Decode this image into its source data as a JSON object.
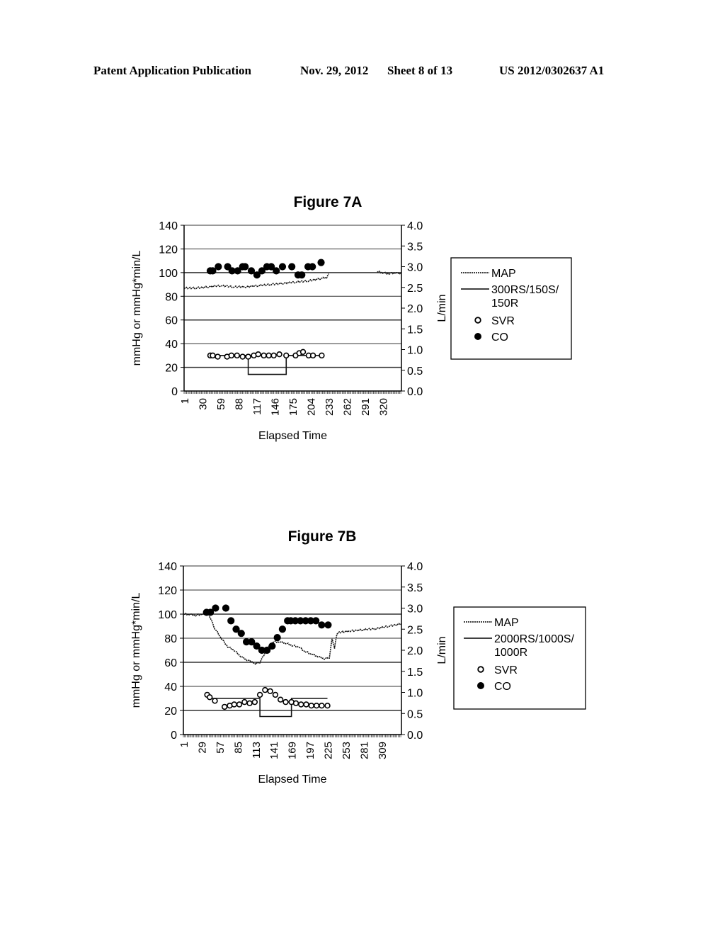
{
  "header": {
    "left": "Patent Application Publication",
    "date": "Nov. 29, 2012",
    "sheet": "Sheet 8 of 13",
    "number": "US 2012/0302637 A1"
  },
  "chart_data": [
    {
      "type": "line",
      "title": "Figure 7A",
      "xlabel": "Elapsed Time",
      "ylabel": "mmHg or mmHg*min/L",
      "y2label": "L/min",
      "xlim": [
        1,
        350
      ],
      "ylim": [
        0,
        140
      ],
      "y2lim": [
        0,
        4.0
      ],
      "x_ticks": [
        "1",
        "30",
        "59",
        "88",
        "117",
        "146",
        "175",
        "204",
        "233",
        "262",
        "291",
        "320"
      ],
      "y_ticks": [
        "0",
        "20",
        "40",
        "60",
        "80",
        "100",
        "120",
        "140"
      ],
      "y2_ticks": [
        "0.0",
        "0.5",
        "1.0",
        "1.5",
        "2.0",
        "2.5",
        "3.0",
        "3.5",
        "4.0"
      ],
      "grid": true,
      "legend": {
        "position": "right",
        "entries": [
          "MAP",
          "300RS/150S/ 150R",
          "SVR",
          "CO"
        ]
      },
      "series": [
        {
          "name": "MAP",
          "style": "dotted-line",
          "axis": "left",
          "segments": [
            {
              "x": [
                1,
                20,
                40,
                60,
                80,
                100,
                120,
                140,
                160,
                180,
                200,
                220,
                230,
                233
              ],
              "y": [
                87,
                87,
                88,
                89,
                88,
                88,
                89,
                90,
                91,
                92,
                93,
                95,
                96,
                99
              ]
            },
            {
              "x": [
                311,
                320,
                330,
                340,
                350
              ],
              "y": [
                101,
                100,
                99,
                100,
                99
              ]
            }
          ]
        },
        {
          "name": "300RS/150S/ 150R",
          "style": "solid-line",
          "axis": "left",
          "x": [
            41,
            104,
            104,
            165,
            165,
            222
          ],
          "y": [
            30,
            30,
            14,
            14,
            30,
            30
          ]
        },
        {
          "name": "SVR",
          "style": "open-circle",
          "axis": "left",
          "x": [
            43,
            47,
            55,
            70,
            77,
            86,
            95,
            104,
            113,
            120,
            129,
            137,
            145,
            154,
            165,
            180,
            186,
            192,
            201,
            208,
            222
          ],
          "y": [
            30,
            30,
            29,
            29,
            30,
            30,
            29,
            29,
            30,
            31,
            30,
            30,
            30,
            31,
            30,
            30,
            32,
            33,
            30,
            30,
            30
          ]
        },
        {
          "name": "CO",
          "style": "filled-circle",
          "axis": "right",
          "x": [
            43,
            47,
            56,
            71,
            78,
            87,
            95,
            99,
            109,
            118,
            126,
            134,
            141,
            149,
            159,
            174,
            184,
            190,
            200,
            207,
            221
          ],
          "y": [
            2.9,
            2.9,
            3.0,
            3.0,
            2.9,
            2.9,
            3.0,
            3.0,
            2.9,
            2.8,
            2.9,
            3.0,
            3.0,
            2.9,
            3.0,
            3.0,
            2.8,
            2.8,
            3.0,
            3.0,
            3.1
          ]
        }
      ]
    },
    {
      "type": "line",
      "title": "Figure 7B",
      "xlabel": "Elapsed Time",
      "ylabel": "mmHg or mmHg*min/L",
      "y2label": "L/min",
      "xlim": [
        1,
        340
      ],
      "ylim": [
        0,
        140
      ],
      "y2lim": [
        0,
        4.0
      ],
      "x_ticks": [
        "1",
        "29",
        "57",
        "85",
        "113",
        "141",
        "169",
        "197",
        "225",
        "253",
        "281",
        "309"
      ],
      "y_ticks": [
        "0",
        "20",
        "40",
        "60",
        "80",
        "100",
        "120",
        "140"
      ],
      "y2_ticks": [
        "0.0",
        "0.5",
        "1.0",
        "1.5",
        "2.0",
        "2.5",
        "3.0",
        "3.5",
        "4.0"
      ],
      "grid": true,
      "legend": {
        "position": "right",
        "entries": [
          "MAP",
          "2000RS/1000S/ 1000R",
          "SVR",
          "CO"
        ]
      },
      "series": [
        {
          "name": "MAP",
          "style": "dotted-line",
          "axis": "left",
          "x": [
            1,
            10,
            20,
            30,
            40,
            42,
            50,
            60,
            70,
            80,
            90,
            100,
            110,
            113,
            120,
            130,
            140,
            150,
            160,
            170,
            180,
            190,
            200,
            210,
            220,
            228,
            232,
            234,
            236,
            238,
            240,
            245,
            260,
            280,
            300,
            320,
            340
          ],
          "y": [
            100,
            100,
            99,
            100,
            101,
            98,
            88,
            80,
            73,
            70,
            65,
            62,
            60,
            59,
            60,
            70,
            77,
            77,
            76,
            74,
            73,
            69,
            67,
            65,
            63,
            64,
            80,
            76,
            72,
            79,
            84,
            85,
            86,
            87,
            88,
            90,
            92
          ]
        },
        {
          "name": "2000RS/1000S/ 1000R",
          "style": "solid-line",
          "axis": "left",
          "x": [
            38,
            120,
            120,
            169,
            169,
            225
          ],
          "y": [
            30,
            30,
            15,
            15,
            30,
            30
          ]
        },
        {
          "name": "SVR",
          "style": "open-circle",
          "axis": "left",
          "x": [
            38,
            42,
            50,
            65,
            73,
            80,
            88,
            96,
            104,
            112,
            120,
            128,
            136,
            144,
            152,
            160,
            169,
            176,
            184,
            192,
            200,
            208,
            216,
            225
          ],
          "y": [
            33,
            31,
            28,
            23,
            24,
            25,
            25,
            27,
            26,
            27,
            33,
            37,
            36,
            33,
            29,
            27,
            27,
            26,
            25,
            25,
            24,
            24,
            24,
            24
          ]
        },
        {
          "name": "CO",
          "style": "filled-circle",
          "axis": "right",
          "x": [
            37,
            43,
            51,
            67,
            75,
            83,
            91,
            99,
            107,
            115,
            123,
            131,
            139,
            147,
            155,
            163,
            168,
            175,
            183,
            191,
            199,
            207,
            216,
            226
          ],
          "y": [
            2.9,
            2.9,
            3.0,
            3.0,
            2.7,
            2.5,
            2.4,
            2.2,
            2.2,
            2.1,
            2.0,
            2.0,
            2.1,
            2.3,
            2.5,
            2.7,
            2.7,
            2.7,
            2.7,
            2.7,
            2.7,
            2.7,
            2.6,
            2.6
          ]
        }
      ]
    }
  ]
}
